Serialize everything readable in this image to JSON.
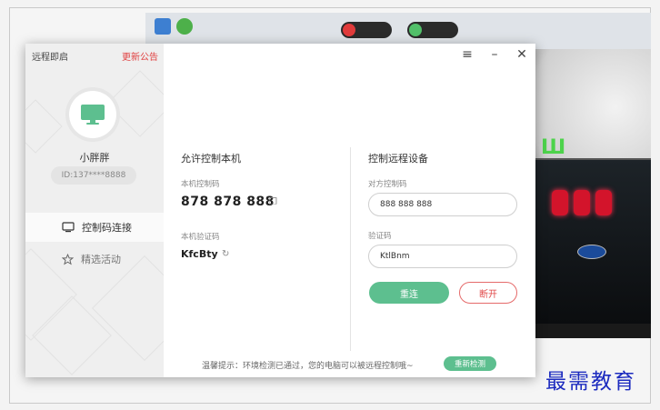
{
  "sidebar": {
    "title": "远程即启",
    "news_link": "更新公告",
    "username": "小胖胖",
    "user_id": "ID:137****8888",
    "items": [
      {
        "label": "控制码连接",
        "icon": "monitor-icon",
        "active": true
      },
      {
        "label": "精选活动",
        "icon": "star-icon",
        "active": false
      }
    ]
  },
  "window_controls": {
    "menu": "≡",
    "minimize": "–",
    "close": "✕"
  },
  "allow_section": {
    "title": "允许控制本机",
    "code_label": "本机控制码",
    "code_value": "878 878 888",
    "verify_label": "本机验证码",
    "verify_value": "KfcBty"
  },
  "control_section": {
    "title": "控制远程设备",
    "peer_code_label": "对方控制码",
    "peer_code_value": "888 888 888",
    "verify_label": "验证码",
    "verify_value": "KtlBnm",
    "connect_button": "重连",
    "disconnect_button": "断开"
  },
  "footer": {
    "status": "温馨提示：环境检测已通过，您的电脑可以被远程控制哦~",
    "recheck_button": "重新检测"
  },
  "watermark": "最需教育",
  "colors": {
    "accent_green": "#5dbf8f",
    "news_red": "#e04040",
    "disconnect_red": "#e04848"
  }
}
